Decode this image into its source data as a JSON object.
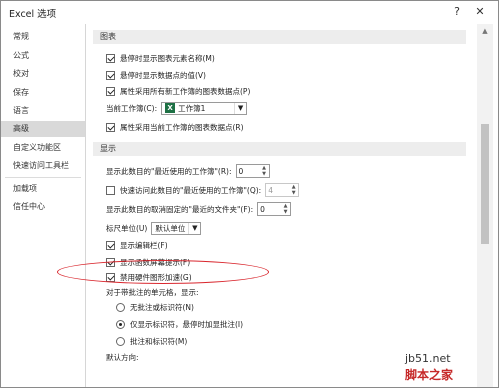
{
  "window": {
    "title": "Excel 选项",
    "help_glyph": "?",
    "close_glyph": "✕"
  },
  "nav": {
    "items": [
      "常规",
      "公式",
      "校对",
      "保存",
      "语言",
      "高级",
      "自定义功能区",
      "快速访问工具栏",
      "加载项",
      "信任中心"
    ],
    "active_index": 5
  },
  "chart_section": {
    "heading": "图表",
    "opt_show_names": "悬停时显示图表元素名称(M)",
    "opt_show_values": "悬停时显示数据点的值(V)",
    "opt_all_new": "属性采用所有新工作簿的图表数据点(P)",
    "current_workbook_label": "当前工作簿(C):",
    "current_workbook_value": "工作簿1",
    "opt_current": "属性采用当前工作簿的图表数据点(R)"
  },
  "display_section": {
    "heading": "显示",
    "recent_workbooks_label": "显示此数目的\"最近使用的工作簿\"(R):",
    "recent_workbooks_value": "0",
    "quick_access_label": "快速访问此数目的\"最近使用的工作簿\"(Q):",
    "quick_access_value": "4",
    "recent_folders_label": "显示此数目的取消固定的\"最近的文件夹\"(F):",
    "recent_folders_value": "0",
    "ruler_label": "标尺单位(U)",
    "ruler_value": "默认单位",
    "opt_formula_bar": "显示编辑栏(F)",
    "opt_function_tips": "显示函数屏幕提示(F)",
    "opt_disable_hw_accel": "禁用硬件图形加速(G)",
    "comments_label": "对于带批注的单元格，显示:",
    "radio_none": "无批注或标识符(N)",
    "radio_indicator": "仅显示标识符，悬停时加显批注(I)",
    "radio_both": "批注和标识符(M)",
    "direction_label": "默认方向:"
  },
  "watermark": {
    "line1": "jb51.net",
    "line2": "脚本之家"
  },
  "colors": {
    "highlight_ellipse": "#d9272e",
    "excel_green": "#1e7145"
  }
}
